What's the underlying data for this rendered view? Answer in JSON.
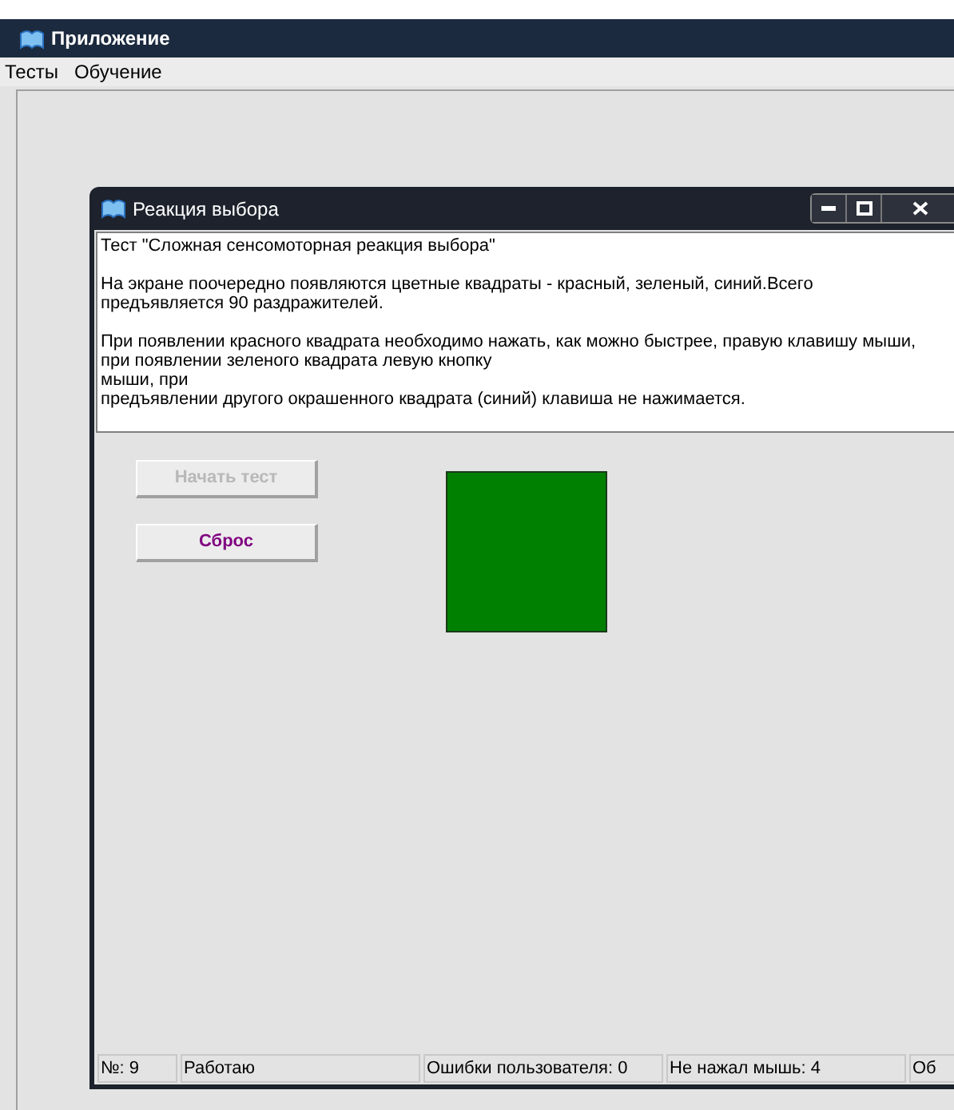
{
  "app_window": {
    "title": "Приложение"
  },
  "menu": [
    {
      "label": "Тесты"
    },
    {
      "label": "Обучение"
    }
  ],
  "child_window": {
    "title": "Реакция выбора",
    "controls": [
      {
        "kind": "minimize"
      },
      {
        "kind": "maximize"
      },
      {
        "kind": "close"
      }
    ]
  },
  "instructions": [
    [
      "Тест \"Сложная сенсомоторная реакция выбора\""
    ],
    [
      "На экране поочередно появляются цветные квадраты - красный, зеленый, синий.Всего",
      "предъявляется 90 раздражителей."
    ],
    [
      "При появлении красного квадрата необходимо нажать, как можно быстрее, правую клавишу мыши,",
      "при появлении зеленого квадрата левую кнопку",
      "мыши, при",
      "предъявлении другого окрашенного квадрата (синий) клавиша не нажимается."
    ]
  ],
  "buttons": [
    {
      "label": "Начать тест",
      "disabled": true
    },
    {
      "label": "Сброс",
      "disabled": false
    }
  ],
  "stimulus": {
    "color": "#008000"
  },
  "status_bar": [
    "№: 9",
    "Работаю",
    "Ошибки пользователя: 0",
    "Не нажал мышь: 4",
    "Об"
  ]
}
